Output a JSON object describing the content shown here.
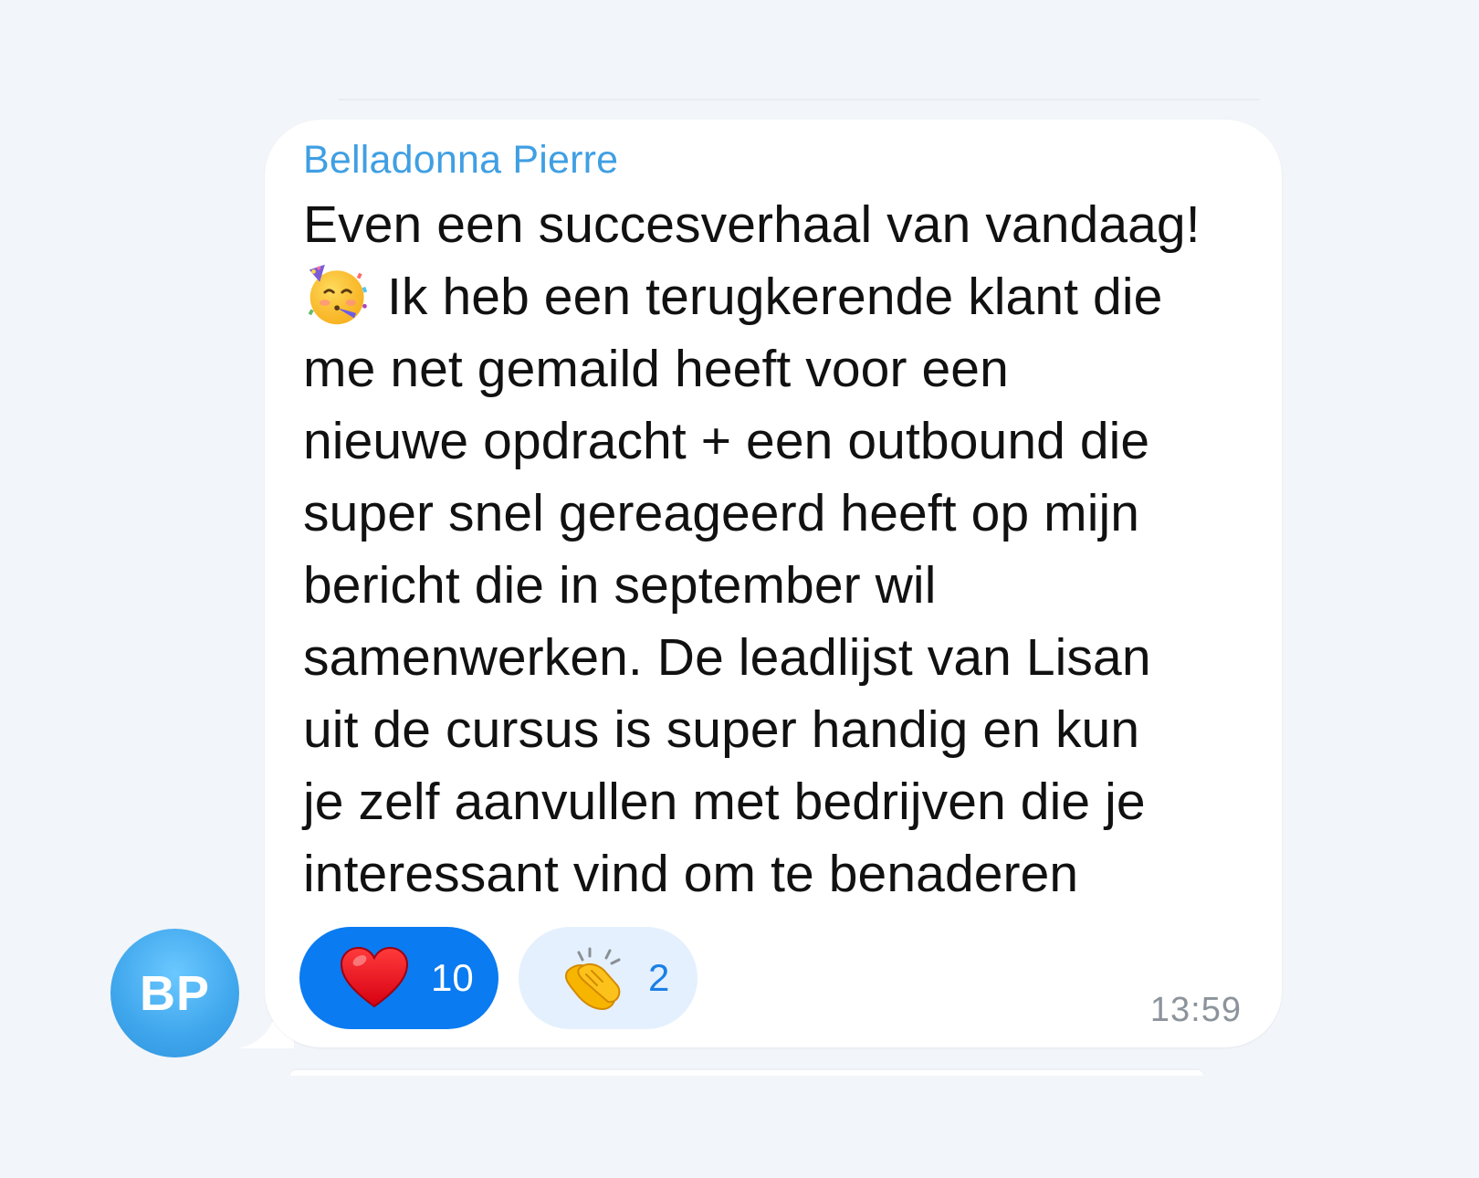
{
  "message": {
    "sender_name": "Belladonna Pierre",
    "text_lines": [
      "Even een succesverhaal van vandaag!",
      "Ik heb een terugkerende klant die",
      "me net gemaild heeft voor een",
      "nieuwe opdracht + een outbound die",
      "super snel gereageerd heeft op mijn",
      "bericht die in september wil",
      "samenwerken. De leadlijst van Lisan",
      "uit de cursus is super handig en kun",
      "je zelf aanvullen met bedrijven die je",
      "interessant vind om te benaderen"
    ],
    "inline_emoji": "partying-face-icon",
    "time": "13:59",
    "reactions": [
      {
        "emoji": "heart-icon",
        "count": "10",
        "selected": true
      },
      {
        "emoji": "clapping-hands-icon",
        "count": "2",
        "selected": false
      }
    ]
  },
  "avatar": {
    "initials": "BP"
  },
  "colors": {
    "background": "#f2f5f9",
    "bubble": "#ffffff",
    "sender_name": "#3f9fe3",
    "reaction_selected": "#0a7bf1",
    "reaction_unselected": "#e4f0fd",
    "avatar": "#3fa6ec",
    "timestamp": "#8c939b"
  }
}
